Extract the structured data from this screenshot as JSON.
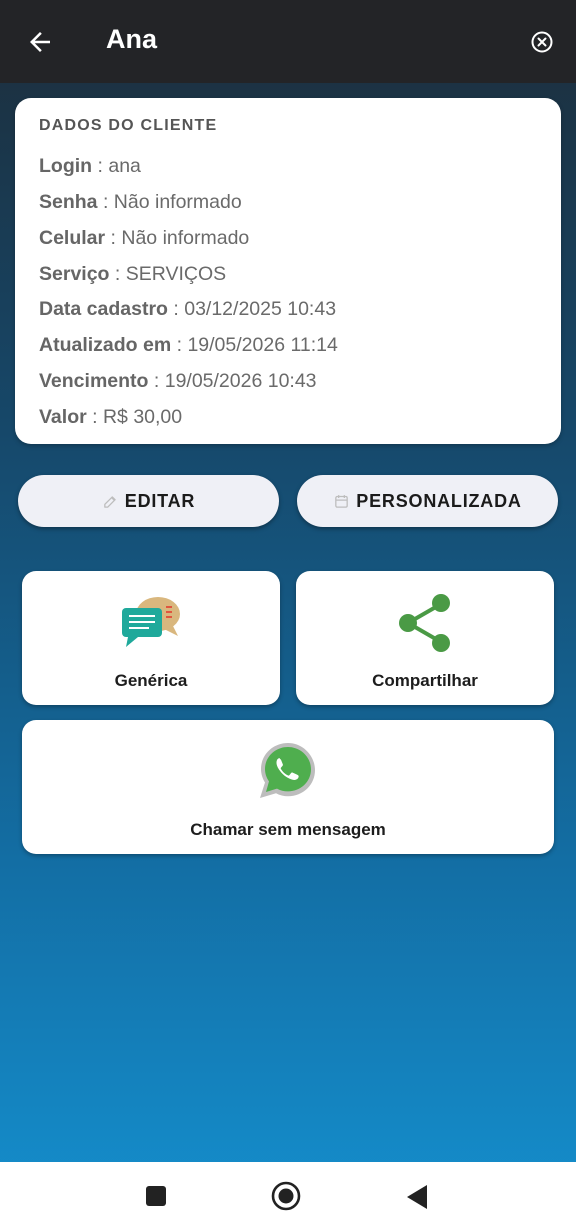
{
  "header": {
    "title": "Ana",
    "back_icon": "arrow-left-icon",
    "close_icon": "close-circle-icon"
  },
  "client_card": {
    "title": "DADOS DO CLIENTE",
    "fields": [
      {
        "label": "Login",
        "sep": " : ",
        "value": "ana"
      },
      {
        "label": "Senha",
        "sep": " : ",
        "value": "Não informado"
      },
      {
        "label": "Celular",
        "sep": " : ",
        "value": "Não informado"
      },
      {
        "label": "Serviço",
        "sep": " : ",
        "value": "SERVIÇOS"
      },
      {
        "label": "Data cadastro",
        "sep": " : ",
        "value": "03/12/2025 10:43"
      },
      {
        "label": "Atualizado em",
        "sep": " : ",
        "value": "19/05/2026 11:14"
      },
      {
        "label": "Vencimento",
        "sep": " : ",
        "value": "19/05/2026 10:43"
      },
      {
        "label": "Valor",
        "sep": " : ",
        "value": "R$ 30,00"
      }
    ]
  },
  "actions": {
    "edit_label": "EDITAR",
    "edit_icon": "edit-icon",
    "custom_label": "PERSONALIZADA",
    "custom_icon": "calendar-icon"
  },
  "tiles": {
    "generic_label": "Genérica",
    "generic_icon": "chat-bubbles-icon",
    "share_label": "Compartilhar",
    "share_icon": "share-icon",
    "whatsapp_label": "Chamar sem mensagem",
    "whatsapp_icon": "whatsapp-icon"
  },
  "colors": {
    "appbar": "#232427",
    "share_green": "#4a9a45",
    "whatsapp_green": "#4fae4e",
    "chat_teal": "#1fa99b",
    "chat_tan": "#d9b77e"
  }
}
